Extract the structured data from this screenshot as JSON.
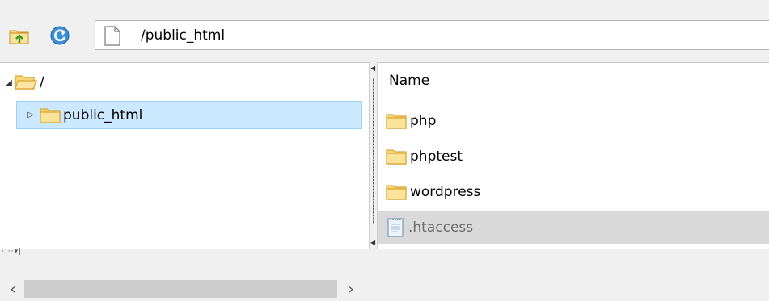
{
  "toolbar": {
    "up_icon": "folder-up-icon",
    "refresh_icon": "refresh-icon",
    "path_icon": "file-icon",
    "path_value": "/public_html"
  },
  "tree": {
    "root": {
      "label": "/",
      "expanded": true
    },
    "children": [
      {
        "label": "public_html",
        "selected": true,
        "expanded": false
      }
    ]
  },
  "file_list": {
    "column_header": "Name",
    "items": [
      {
        "name": "php",
        "type": "folder"
      },
      {
        "name": "phptest",
        "type": "folder"
      },
      {
        "name": "wordpress",
        "type": "folder"
      },
      {
        "name": ".htaccess",
        "type": "file",
        "selected": true
      }
    ]
  },
  "colors": {
    "selection_fill": "#cce8ff",
    "selection_border": "#99d1ff",
    "folder_fill": "#f8d775",
    "folder_border": "#d8a530",
    "row_selected": "#d9d9d9"
  }
}
